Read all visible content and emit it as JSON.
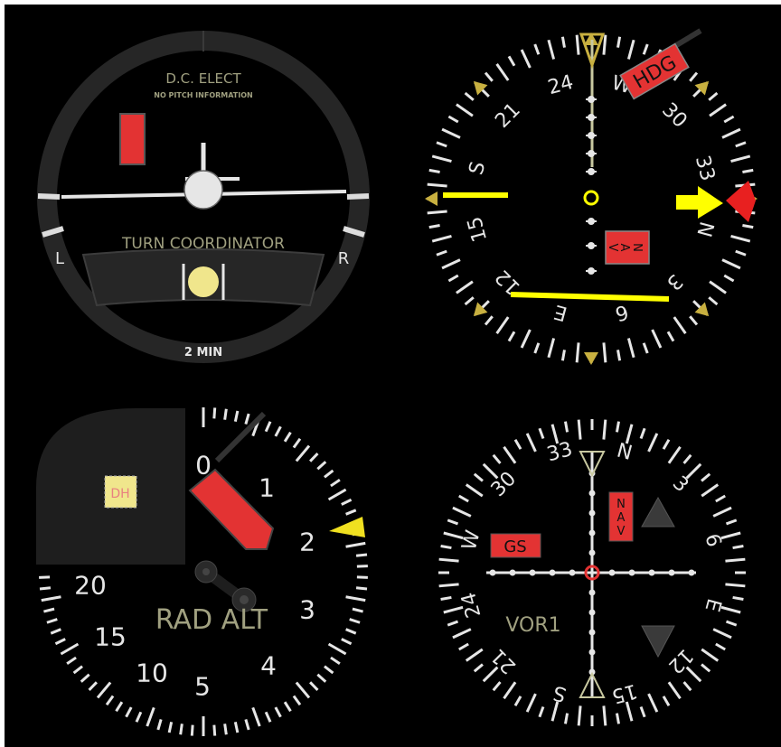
{
  "turn_coordinator": {
    "top_text": "D.C. ELECT",
    "sub_text": "NO PITCH INFORMATION",
    "title": "TURN COORDINATOR",
    "left_label": "L",
    "right_label": "R",
    "bottom_label": "2 MIN",
    "colors": {
      "bezel": "#262626",
      "face": "#000000",
      "flag": "#e33333",
      "ball": "#f0e68c",
      "text": "#a0a080"
    }
  },
  "hsi": {
    "compass_labels": [
      "N",
      "3",
      "6",
      "E",
      "12",
      "15",
      "S",
      "21",
      "24",
      "W",
      "30",
      "33"
    ],
    "heading_deg": 255,
    "hdg_flag": "HDG",
    "nav_flag": "NAV",
    "colors": {
      "needle": "#ffff00",
      "flag": "#e33333",
      "marker": "#c8b040",
      "heading_bug": "#e82020"
    }
  },
  "radar_altimeter": {
    "scale_labels": [
      "0",
      "1",
      "2",
      "3",
      "4",
      "5",
      "10",
      "15",
      "20"
    ],
    "dh_label": "DH",
    "title": "RAD ALT",
    "colors": {
      "flag": "#e33333",
      "bug": "#f0e020",
      "text": "#a0a080",
      "dh_bg": "#f0e68c"
    }
  },
  "vor_indicator": {
    "compass_labels": [
      "N",
      "3",
      "6",
      "E",
      "12",
      "15",
      "S",
      "21",
      "24",
      "W",
      "30",
      "33"
    ],
    "heading_deg": 345,
    "gs_flag": "GS",
    "nav_flag": "NAV",
    "title": "VOR1",
    "colors": {
      "flag": "#e33333",
      "text": "#a0a080",
      "dot": "#e33333"
    }
  }
}
